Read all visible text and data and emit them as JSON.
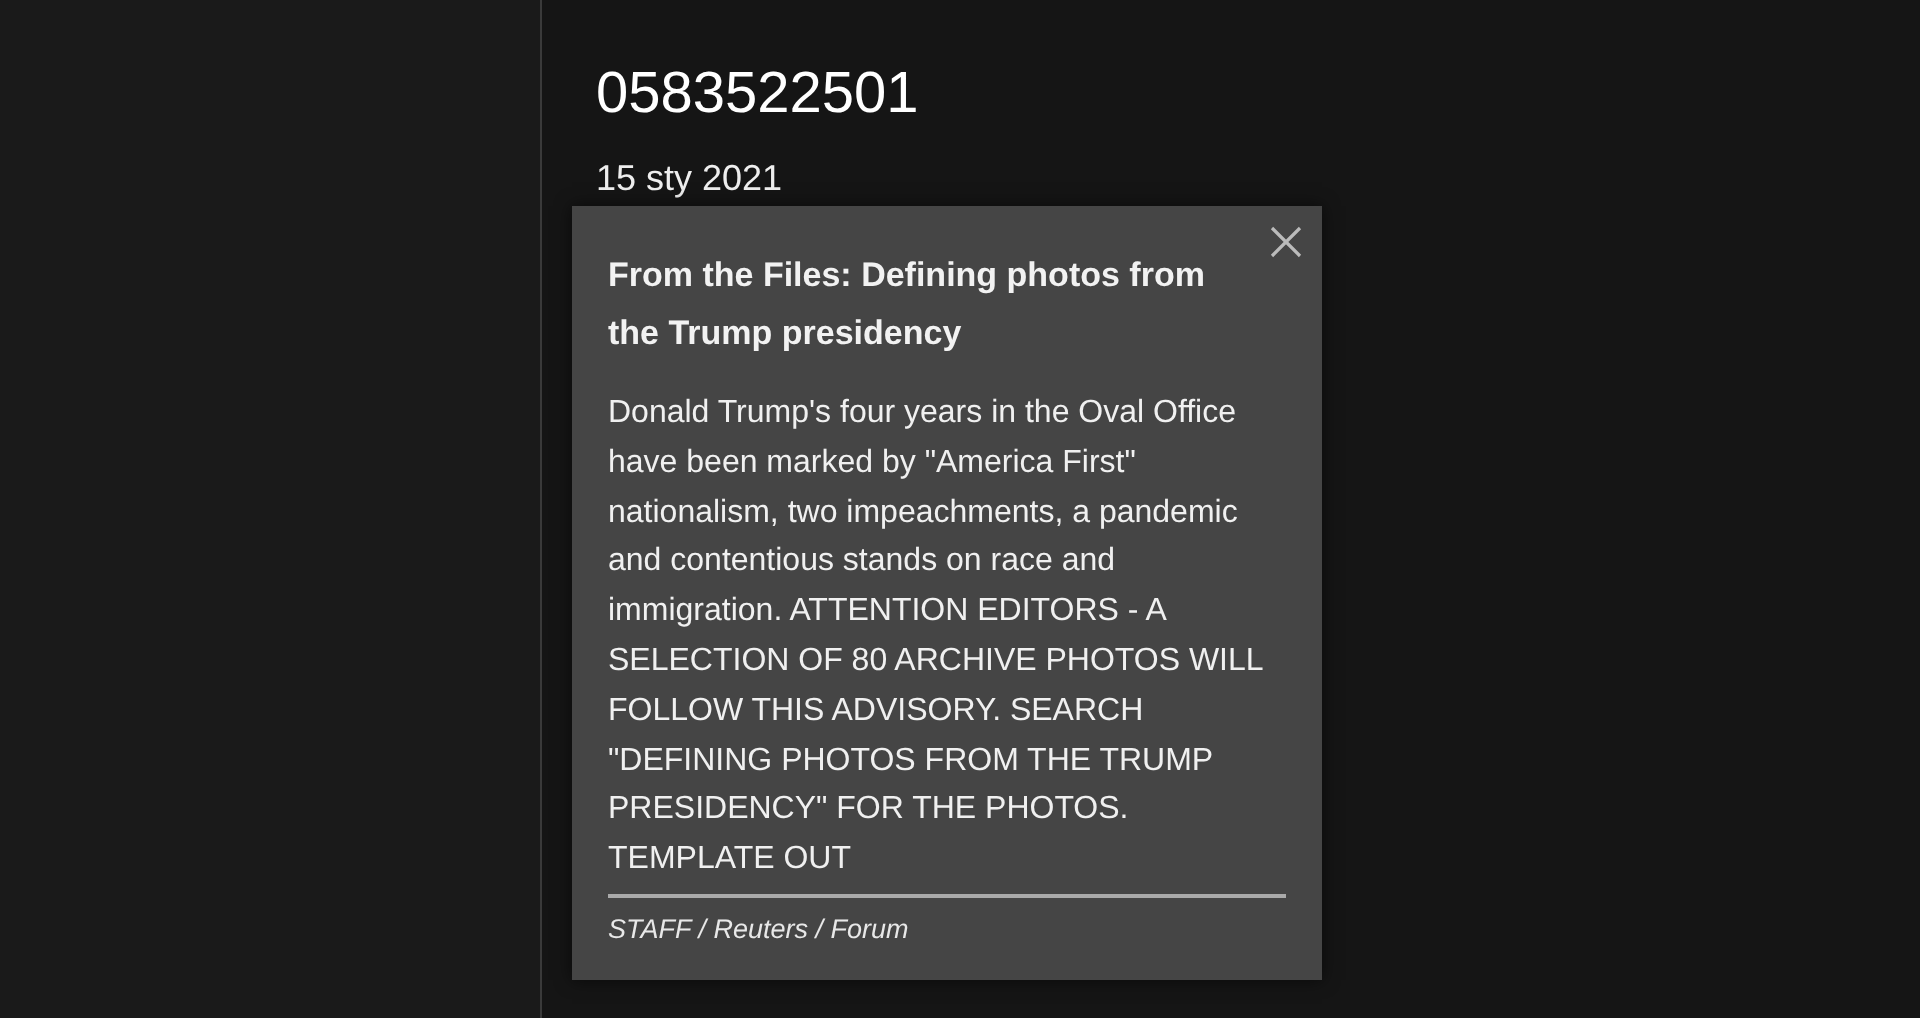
{
  "header": {
    "title": "0583522501",
    "date": "15 sty 2021"
  },
  "caption_popup": {
    "title": "From the Files: Defining photos from the Trump presidency",
    "body": "Donald Trump's four years in the Oval Office have been marked by \"America First\" nationalism, two impeachments, a pandemic and contentious stands on race and immigration. ATTENTION EDITORS - A SELECTION OF 80 ARCHIVE PHOTOS WILL FOLLOW THIS ADVISORY. SEARCH \"DEFINING PHOTOS FROM THE TRUMP PRESIDENCY\" FOR THE PHOTOS. TEMPLATE OUT",
    "credit": "STAFF / Reuters / Forum"
  }
}
